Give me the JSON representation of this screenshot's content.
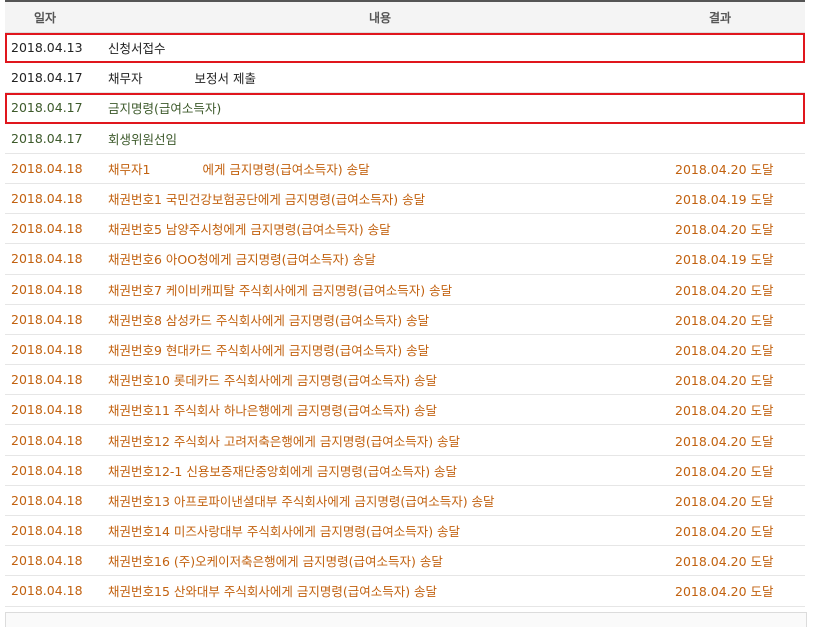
{
  "header": {
    "date": "일자",
    "content": "내용",
    "result": "결과"
  },
  "rows": [
    {
      "date": "2018.04.13",
      "content": "신청서접수",
      "result": "",
      "color": "black",
      "highlight": true
    },
    {
      "date": "2018.04.17",
      "content_a": "채무자",
      "content_b": "보정서 제출",
      "result": "",
      "color": "black",
      "highlight": false
    },
    {
      "date": "2018.04.17",
      "content": "금지명령(급여소득자)",
      "result": "",
      "color": "green",
      "highlight": true
    },
    {
      "date": "2018.04.17",
      "content": "회생위원선임",
      "result": "",
      "color": "green",
      "highlight": false
    },
    {
      "date": "2018.04.18",
      "content_a": "채무자1",
      "content_b": "에게 금지명령(급여소득자) 송달",
      "result": "2018.04.20 도달",
      "color": "orange"
    },
    {
      "date": "2018.04.18",
      "content": "채권번호1 국민건강보험공단에게 금지명령(급여소득자) 송달",
      "result": "2018.04.19 도달",
      "color": "orange"
    },
    {
      "date": "2018.04.18",
      "content": "채권번호5 남양주시청에게 금지명령(급여소득자) 송달",
      "result": "2018.04.20 도달",
      "color": "orange"
    },
    {
      "date": "2018.04.18",
      "content": "채권번호6 아OO청에게 금지명령(급여소득자) 송달",
      "result": "2018.04.19 도달",
      "color": "orange"
    },
    {
      "date": "2018.04.18",
      "content": "채권번호7 케이비캐피탈 주식회사에게 금지명령(급여소득자) 송달",
      "result": "2018.04.20 도달",
      "color": "orange"
    },
    {
      "date": "2018.04.18",
      "content": "채권번호8 삼성카드 주식회사에게 금지명령(급여소득자) 송달",
      "result": "2018.04.20 도달",
      "color": "orange"
    },
    {
      "date": "2018.04.18",
      "content": "채권번호9 현대카드 주식회사에게 금지명령(급여소득자) 송달",
      "result": "2018.04.20 도달",
      "color": "orange"
    },
    {
      "date": "2018.04.18",
      "content": "채권번호10 롯데카드 주식회사에게 금지명령(급여소득자) 송달",
      "result": "2018.04.20 도달",
      "color": "orange"
    },
    {
      "date": "2018.04.18",
      "content": "채권번호11 주식회사 하나은행에게 금지명령(급여소득자) 송달",
      "result": "2018.04.20 도달",
      "color": "orange"
    },
    {
      "date": "2018.04.18",
      "content": "채권번호12 주식회사 고려저축은행에게 금지명령(급여소득자) 송달",
      "result": "2018.04.20 도달",
      "color": "orange"
    },
    {
      "date": "2018.04.18",
      "content": "채권번호12-1 신용보증재단중앙회에게 금지명령(급여소득자) 송달",
      "result": "2018.04.20 도달",
      "color": "orange"
    },
    {
      "date": "2018.04.18",
      "content": "채권번호13 아프로파이낸셜대부 주식회사에게 금지명령(급여소득자) 송달",
      "result": "2018.04.20 도달",
      "color": "orange"
    },
    {
      "date": "2018.04.18",
      "content": "채권번호14 미즈사랑대부 주식회사에게 금지명령(급여소득자) 송달",
      "result": "2018.04.20 도달",
      "color": "orange"
    },
    {
      "date": "2018.04.18",
      "content": "채권번호16 (주)오케이저축은행에게 금지명령(급여소득자) 송달",
      "result": "2018.04.20 도달",
      "color": "orange"
    },
    {
      "date": "2018.04.18",
      "content": "채권번호15 산와대부 주식회사에게 금지명령(급여소득자) 송달",
      "result": "2018.04.20 도달",
      "color": "orange"
    }
  ],
  "colors": {
    "black": "#222222",
    "green": "#3d5a2b",
    "orange": "#c2610f",
    "highlight": "#e0161d"
  }
}
